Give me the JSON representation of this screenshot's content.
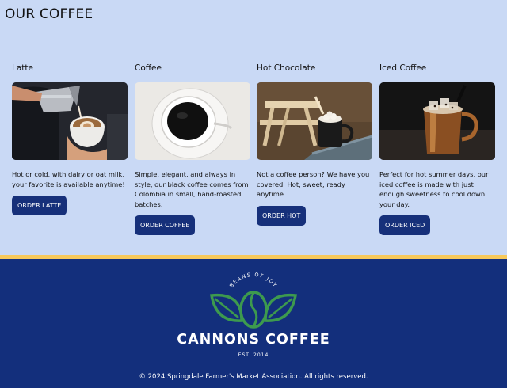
{
  "page": {
    "title": "OUR COFFEE"
  },
  "cards": [
    {
      "title": "Latte",
      "description": "Hot or cold, with dairy or oat milk, your favorite is available anytime!",
      "button": "ORDER LATTE",
      "image": "latte-pour-photo"
    },
    {
      "title": "Coffee",
      "description": "Simple, elegant, and always in style, our black coffee comes from Colombia in small, hand-roasted batches.",
      "button": "ORDER COFFEE",
      "image": "black-coffee-cup-photo"
    },
    {
      "title": "Hot Chocolate",
      "description": "Not a coffee person? We have you covered. Hot, sweet, ready anytime.",
      "button": "ORDER HOT",
      "image": "hot-chocolate-mug-photo"
    },
    {
      "title": "Iced Coffee",
      "description": "Perfect for hot summer days, our iced coffee is made with just enough sweetness to cool down your day.",
      "button": "ORDER ICED",
      "image": "iced-coffee-glass-photo"
    }
  ],
  "footer": {
    "logo_arc_text": "BEANS OF JOY",
    "brand": "CANNONS COFFEE",
    "established": "EST. 2014",
    "copyright": "© 2024 Springdale Farmer's Market Association. All rights reserved."
  },
  "colors": {
    "background": "#c9d9f5",
    "button": "#16307a",
    "footer": "#132f7c",
    "stripe": "#f6c85a",
    "leaf": "#3d9a4e"
  }
}
